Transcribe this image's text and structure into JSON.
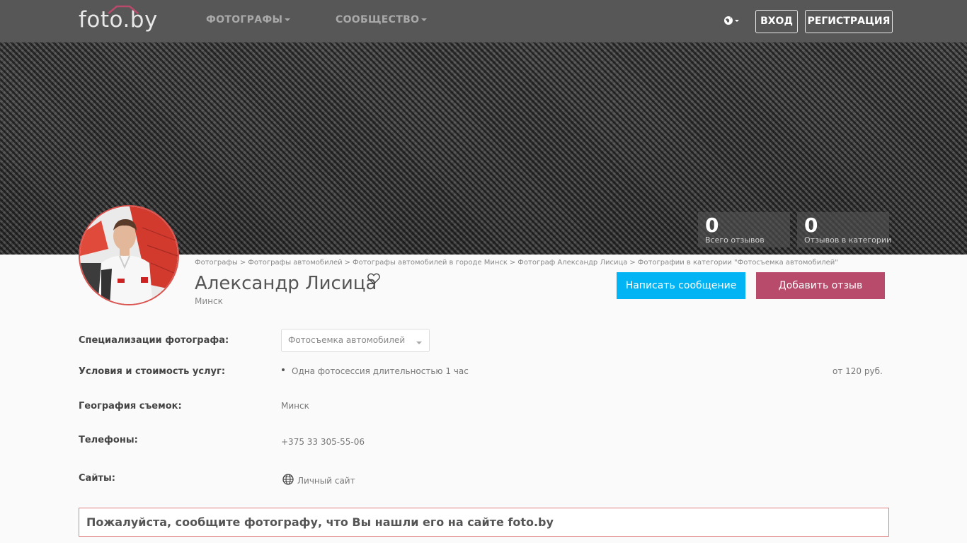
{
  "header": {
    "logo": "foto.by",
    "nav": [
      {
        "label": "ФОТОГРАФЫ"
      },
      {
        "label": "СООБЩЕСТВО"
      }
    ],
    "login_label": "ВХОД",
    "register_label": "РЕГИСТРАЦИЯ"
  },
  "stats": [
    {
      "value": "0",
      "label": "Всего отзывов"
    },
    {
      "value": "0",
      "label": "Отзывов в категории"
    }
  ],
  "breadcrumb": [
    "Фотографы",
    "Фотографы автомобилей",
    "Фотографы автомобилей в городе Минск",
    "Фотограф Александр Лисица",
    "Фотографии в категории \"Фотосъемка автомобилей\""
  ],
  "breadcrumb_sep": ">",
  "profile": {
    "name": "Александр Лисица",
    "city": "Минск"
  },
  "actions": {
    "message_label": "Написать сообщение",
    "review_label": "Добавить отзыв"
  },
  "info": {
    "specializations_label": "Специализации фотографа:",
    "specialization_selected": "Фотосъемка автомобилей",
    "conditions_label": "Условия и стоимость услуг:",
    "condition_item": "Одна фотосессия длительностью 1 час",
    "condition_price": "от 120 руб.",
    "geography_label": "География съемок:",
    "geography_value": "Минск",
    "phones_label": "Телефоны:",
    "phone_value": "+375 33 305-55-06",
    "sites_label": "Сайты:",
    "site_link": "Личный сайт"
  },
  "notice": "Пожалуйста, сообщите фотографу, что Вы нашли его на сайте foto.by",
  "icons": [
    "globe-icon",
    "heart-icon",
    "caret-down-icon",
    "web-icon"
  ],
  "colors": {
    "header_bg": "#575757",
    "message_btn": "#03b4f4",
    "review_btn": "#b84a6c",
    "notice_border": "#e08080"
  }
}
